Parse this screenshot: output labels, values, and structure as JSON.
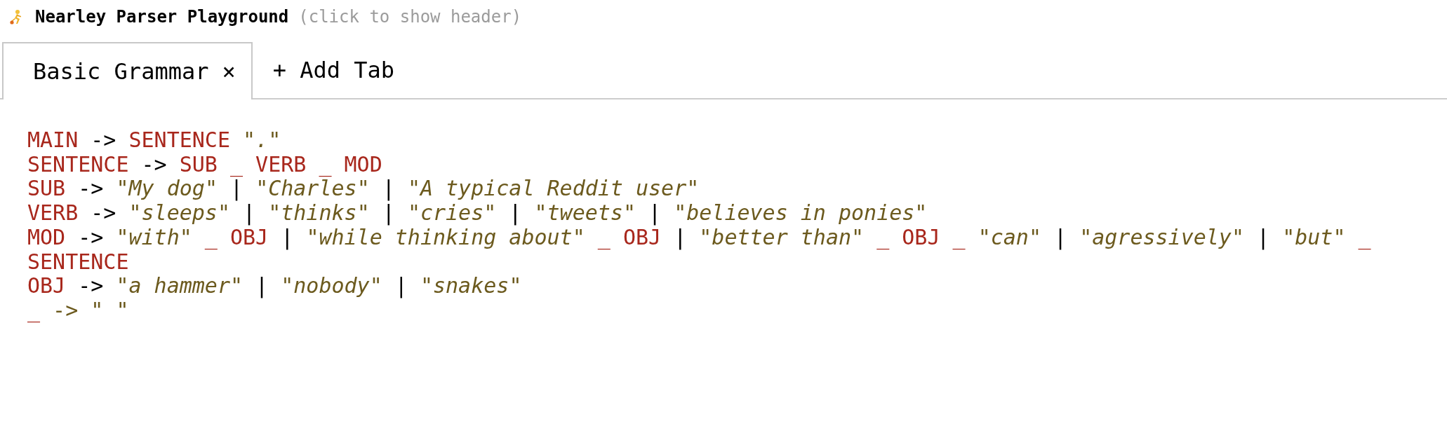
{
  "header": {
    "title": "Nearley Parser Playground",
    "hint": "(click to show header)"
  },
  "tabs": [
    {
      "label": "Basic Grammar",
      "close": "×",
      "selected": true
    }
  ],
  "add_tab": "+ Add Tab",
  "editor": {
    "lines": [
      [
        {
          "kind": "name",
          "text": "MAIN"
        },
        {
          "kind": "plain",
          "text": " -> "
        },
        {
          "kind": "name",
          "text": "SENTENCE"
        },
        {
          "kind": "mark",
          "text": " \""
        },
        {
          "kind": "literal",
          "text": "."
        },
        {
          "kind": "mark",
          "text": "\""
        }
      ],
      [
        {
          "kind": "name",
          "text": "SENTENCE"
        },
        {
          "kind": "plain",
          "text": " -> "
        },
        {
          "kind": "name",
          "text": "SUB _ VERB _ MOD"
        }
      ],
      [
        {
          "kind": "name",
          "text": "SUB"
        },
        {
          "kind": "plain",
          "text": " -> "
        },
        {
          "kind": "mark",
          "text": "\""
        },
        {
          "kind": "literal",
          "text": "My dog"
        },
        {
          "kind": "mark",
          "text": "\""
        },
        {
          "kind": "plain",
          "text": " | "
        },
        {
          "kind": "mark",
          "text": "\""
        },
        {
          "kind": "literal",
          "text": "Charles"
        },
        {
          "kind": "mark",
          "text": "\""
        },
        {
          "kind": "plain",
          "text": " | "
        },
        {
          "kind": "mark",
          "text": "\""
        },
        {
          "kind": "literal",
          "text": "A typical Reddit user"
        },
        {
          "kind": "mark",
          "text": "\""
        }
      ],
      [
        {
          "kind": "name",
          "text": "VERB"
        },
        {
          "kind": "plain",
          "text": " -> "
        },
        {
          "kind": "mark",
          "text": "\""
        },
        {
          "kind": "literal",
          "text": "sleeps"
        },
        {
          "kind": "mark",
          "text": "\""
        },
        {
          "kind": "plain",
          "text": " | "
        },
        {
          "kind": "mark",
          "text": "\""
        },
        {
          "kind": "literal",
          "text": "thinks"
        },
        {
          "kind": "mark",
          "text": "\""
        },
        {
          "kind": "plain",
          "text": " | "
        },
        {
          "kind": "mark",
          "text": "\""
        },
        {
          "kind": "literal",
          "text": "cries"
        },
        {
          "kind": "mark",
          "text": "\""
        },
        {
          "kind": "plain",
          "text": " | "
        },
        {
          "kind": "mark",
          "text": "\""
        },
        {
          "kind": "literal",
          "text": "tweets"
        },
        {
          "kind": "mark",
          "text": "\""
        },
        {
          "kind": "plain",
          "text": " | "
        },
        {
          "kind": "mark",
          "text": "\""
        },
        {
          "kind": "literal",
          "text": "believes in ponies"
        },
        {
          "kind": "mark",
          "text": "\""
        }
      ],
      [
        {
          "kind": "name",
          "text": "MOD"
        },
        {
          "kind": "plain",
          "text": " -> "
        },
        {
          "kind": "mark",
          "text": "\""
        },
        {
          "kind": "literal",
          "text": "with"
        },
        {
          "kind": "mark",
          "text": "\""
        },
        {
          "kind": "name",
          "text": " _ OBJ"
        },
        {
          "kind": "plain",
          "text": " | "
        },
        {
          "kind": "mark",
          "text": "\""
        },
        {
          "kind": "literal",
          "text": "while thinking about"
        },
        {
          "kind": "mark",
          "text": "\""
        },
        {
          "kind": "name",
          "text": " _ OBJ"
        },
        {
          "kind": "plain",
          "text": " | "
        },
        {
          "kind": "mark",
          "text": "\""
        },
        {
          "kind": "literal",
          "text": "better than"
        },
        {
          "kind": "mark",
          "text": "\""
        },
        {
          "kind": "name",
          "text": " _ OBJ _ "
        },
        {
          "kind": "mark",
          "text": "\""
        },
        {
          "kind": "literal",
          "text": "can"
        },
        {
          "kind": "mark",
          "text": "\""
        },
        {
          "kind": "plain",
          "text": " | "
        },
        {
          "kind": "mark",
          "text": "\""
        },
        {
          "kind": "literal",
          "text": "agressively"
        },
        {
          "kind": "mark",
          "text": "\""
        },
        {
          "kind": "plain",
          "text": " | "
        },
        {
          "kind": "mark",
          "text": "\""
        },
        {
          "kind": "literal",
          "text": "but"
        },
        {
          "kind": "mark",
          "text": "\""
        },
        {
          "kind": "name",
          "text": " _"
        }
      ],
      [
        {
          "kind": "name",
          "text": "SENTENCE"
        }
      ],
      [
        {
          "kind": "name",
          "text": "OBJ"
        },
        {
          "kind": "plain",
          "text": " -> "
        },
        {
          "kind": "mark",
          "text": "\""
        },
        {
          "kind": "literal",
          "text": "a hammer"
        },
        {
          "kind": "mark",
          "text": "\""
        },
        {
          "kind": "plain",
          "text": " | "
        },
        {
          "kind": "mark",
          "text": "\""
        },
        {
          "kind": "literal",
          "text": "nobody"
        },
        {
          "kind": "mark",
          "text": "\""
        },
        {
          "kind": "plain",
          "text": " | "
        },
        {
          "kind": "mark",
          "text": "\""
        },
        {
          "kind": "literal",
          "text": "snakes"
        },
        {
          "kind": "mark",
          "text": "\""
        }
      ],
      [
        {
          "kind": "name",
          "text": "_"
        },
        {
          "kind": "mark",
          "text": " -> \" \""
        }
      ]
    ]
  }
}
